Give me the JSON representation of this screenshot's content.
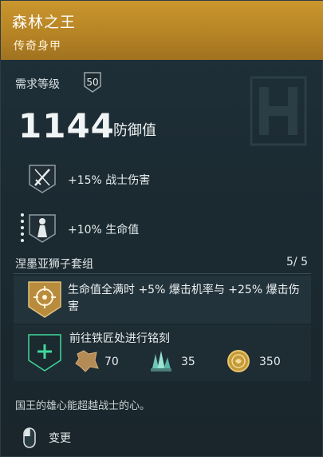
{
  "item": {
    "name": "森林之王",
    "rarity": "传奇身甲",
    "rarity_color": "#c2902a"
  },
  "requirement": {
    "label": "需求等级",
    "level": "50"
  },
  "defense": {
    "value": "1144",
    "label": "防御值"
  },
  "perks": [
    {
      "icon": "warrior-swords-icon",
      "text": "+15% 战士伤害"
    },
    {
      "icon": "health-figure-icon",
      "text": "+10% 生命值"
    }
  ],
  "set": {
    "name": "涅墨亚狮子套组",
    "count": "5/ 5",
    "bonus_icon": "set-target-icon",
    "bonus_text": "生命值全满时 +5% 爆击机率与 +25% 爆击伤害"
  },
  "engrave": {
    "title": "前往铁匠处进行铭刻",
    "icon": "plus-icon",
    "resources": [
      {
        "icon": "leather-icon",
        "amount": "70"
      },
      {
        "icon": "crystal-icon",
        "amount": "35"
      },
      {
        "icon": "drachmae-coin-icon",
        "amount": "350"
      }
    ]
  },
  "flavor": "国王的雄心能超越战士的心。",
  "actions": {
    "change_label": "变更",
    "change_icon": "mouse-icon"
  }
}
